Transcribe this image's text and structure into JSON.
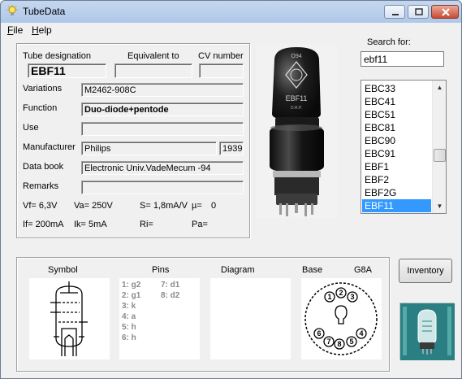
{
  "window": {
    "title": "TubeData"
  },
  "menu": {
    "file_pre": "",
    "file_u": "F",
    "file_rest": "ile",
    "help_u": "H",
    "help_rest": "elp"
  },
  "details": {
    "tube_designation_label": "Tube designation",
    "tube_designation": "EBF11",
    "equivalent_label": "Equivalent to",
    "equivalent": "",
    "cv_label": "CV number",
    "cv": "",
    "variations_label": "Variations",
    "variations": "M2462-908C",
    "function_label": "Function",
    "function": "Duo-diode+pentode",
    "use_label": "Use",
    "use": "",
    "manufacturer_label": "Manufacturer",
    "manufacturer": "Philips",
    "year": "1939",
    "databook_label": "Data book",
    "databook": "Electronic Univ.VadeMecum -94",
    "remarks_label": "Remarks",
    "remarks": "",
    "vf": "Vf= 6,3V",
    "va": "Va= 250V",
    "s": "S= 1,8mA/V",
    "mu": "µ=",
    "mu_val": "0",
    "if": "If= 200mA",
    "ik": "Ik= 5mA",
    "ri": "Ri=",
    "pa": "Pa="
  },
  "search": {
    "label": "Search for:",
    "value": "ebf11",
    "items": [
      "EBC33",
      "EBC41",
      "EBC51",
      "EBC81",
      "EBC90",
      "EBC91",
      "EBF1",
      "EBF2",
      "EBF2G",
      "EBF11"
    ],
    "selected": "EBF11"
  },
  "bottom": {
    "symbol_label": "Symbol",
    "pins_label": "Pins",
    "diagram_label": "Diagram",
    "base_label": "Base",
    "base_type": "G8A",
    "pins_col1": [
      "1: g2",
      "2: g1",
      "3: k",
      "4: a",
      "5: h",
      "6: h"
    ],
    "pins_col2": [
      "7: d1",
      "8: d2"
    ],
    "base_numbers": [
      "1",
      "2",
      "3",
      "4",
      "5",
      "6",
      "7",
      "8"
    ],
    "inventory_label": "Inventory"
  },
  "photo": {
    "top_mark": "O94",
    "brand": "EBF11",
    "sub_mark": "D.R.P."
  }
}
